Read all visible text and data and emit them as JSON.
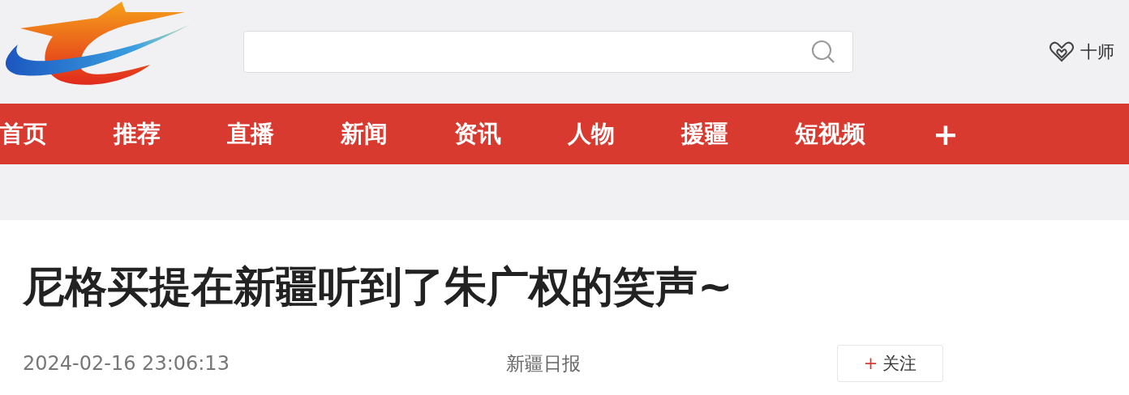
{
  "header": {
    "user_link": "十师"
  },
  "nav": {
    "items": [
      {
        "label": "首页"
      },
      {
        "label": "推荐"
      },
      {
        "label": "直播"
      },
      {
        "label": "新闻"
      },
      {
        "label": "资讯"
      },
      {
        "label": "人物"
      },
      {
        "label": "援疆"
      },
      {
        "label": "短视频"
      }
    ],
    "more": "+"
  },
  "article": {
    "title": "尼格买提在新疆听到了朱广权的笑声~",
    "time": "2024-02-16 23:06:13",
    "source": "新疆日报",
    "follow": {
      "icon": "+",
      "label": "关注"
    }
  }
}
